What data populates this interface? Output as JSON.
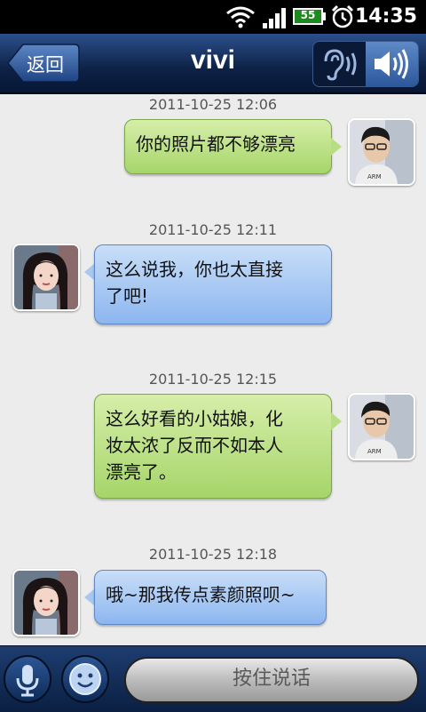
{
  "status_bar": {
    "battery": "55",
    "time": "14:35"
  },
  "header": {
    "back_label": "返回",
    "title": "vivi",
    "earpiece_icon": "ear-icon",
    "speaker_icon": "speaker-icon"
  },
  "messages": [
    {
      "timestamp": "2011-10-25 12:06",
      "sender": "me",
      "text": "你的照片都不够漂亮"
    },
    {
      "timestamp": "2011-10-25 12:11",
      "sender": "vivi",
      "lines": [
        "这么说我，你也太直接",
        "了吧!"
      ]
    },
    {
      "timestamp": "2011-10-25 12:15",
      "sender": "me",
      "lines": [
        "这么好看的小姑娘，化",
        "妆太浓了反而不如本人",
        "漂亮了。"
      ]
    },
    {
      "timestamp": "2011-10-25 12:18",
      "sender": "vivi",
      "text": "哦~那我传点素颜照呗~"
    }
  ],
  "input_bar": {
    "talk_label": "按住说话",
    "mic_icon": "microphone-icon",
    "emoji_icon": "smiley-icon"
  },
  "colors": {
    "sent_bubble": "#a6d56a",
    "received_bubble": "#8cb6ef",
    "header_bg": "#0d2246"
  }
}
